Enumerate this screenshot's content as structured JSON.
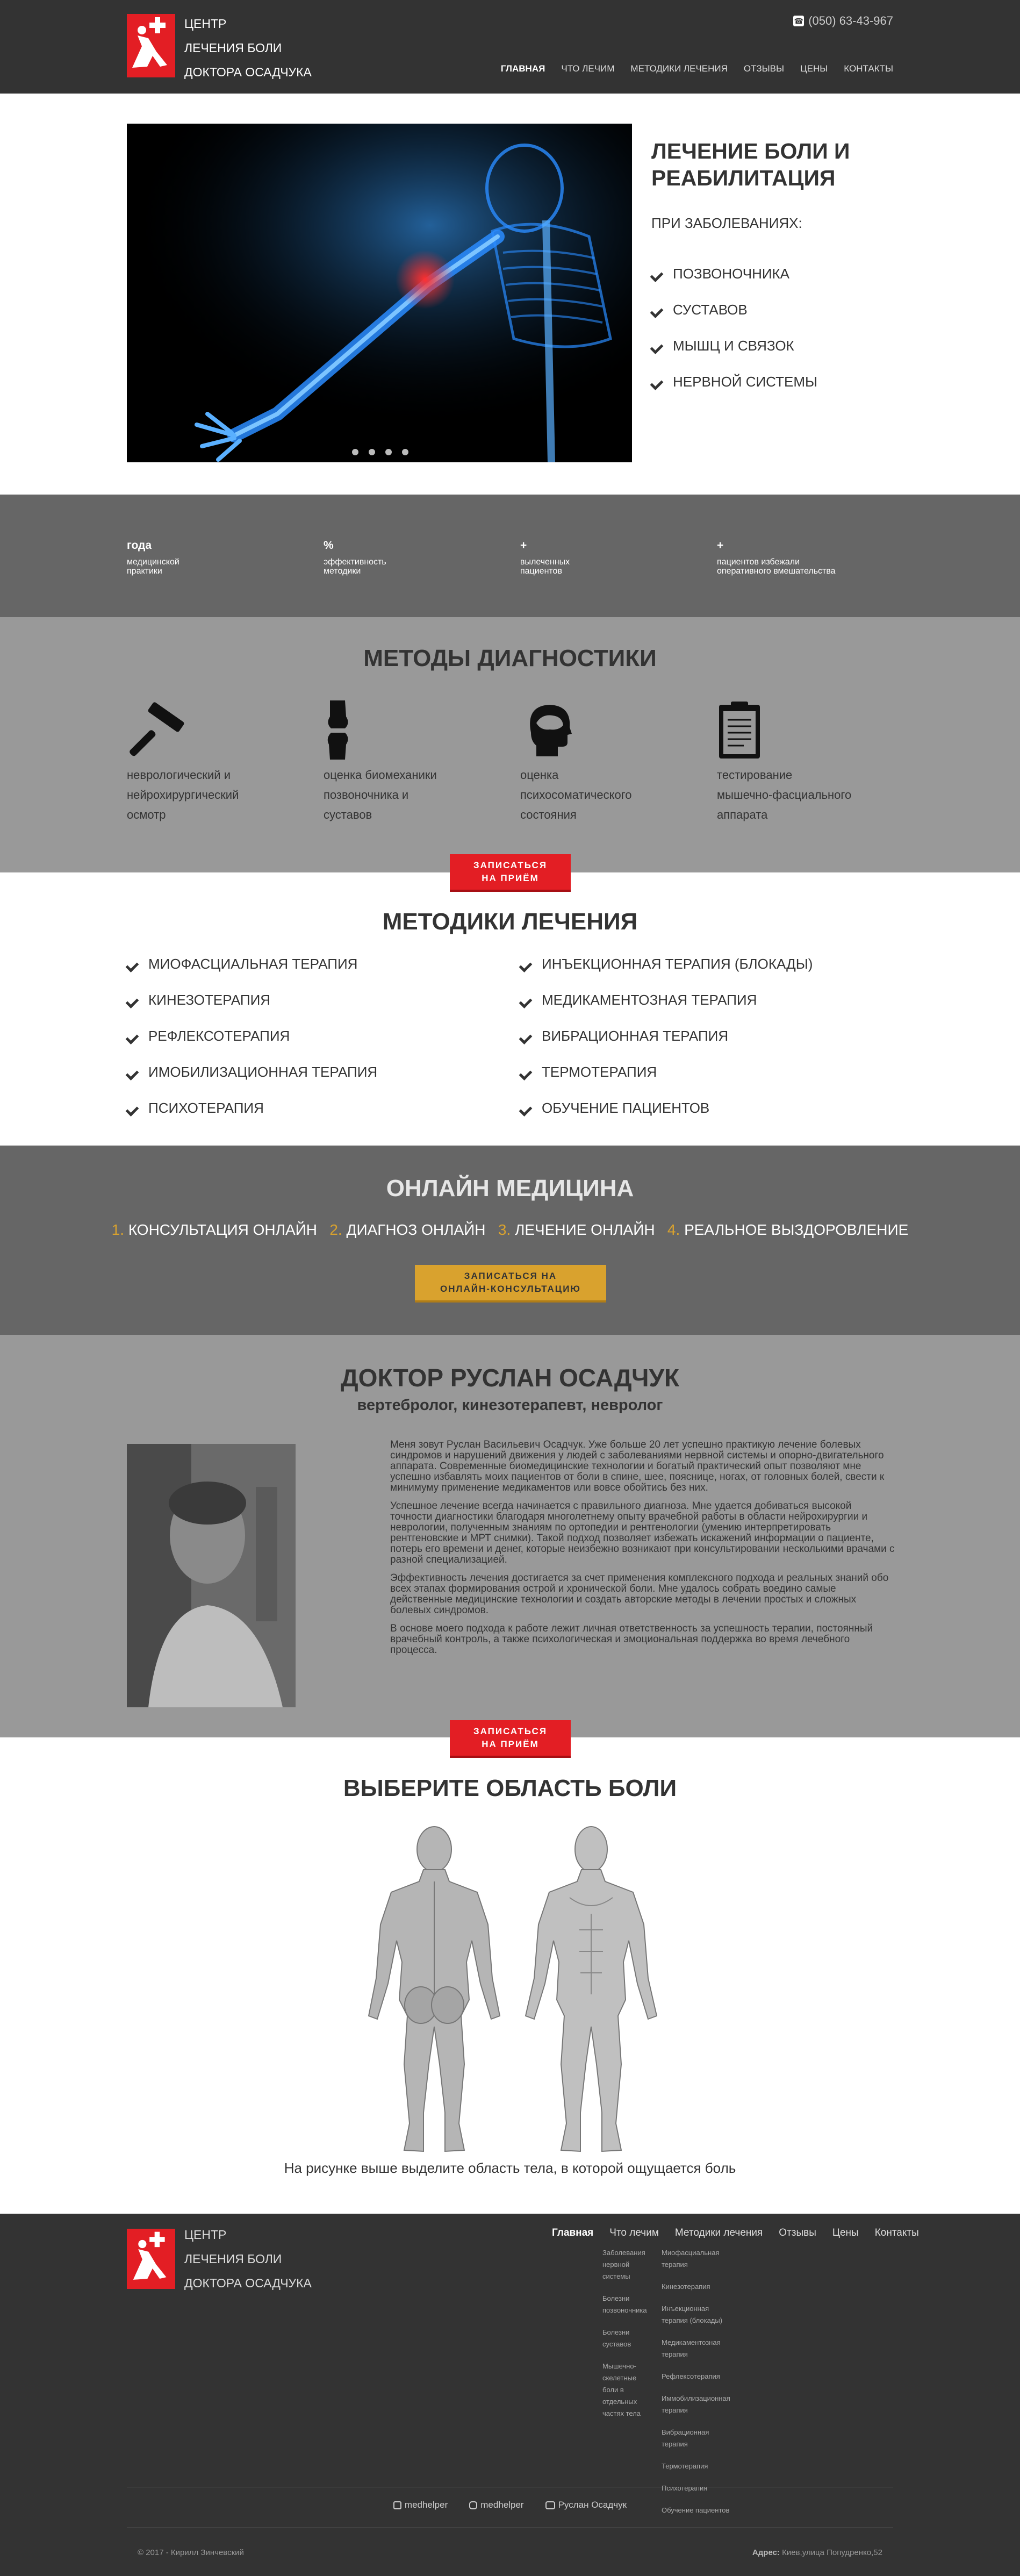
{
  "header": {
    "logo_lines": [
      "ЦЕНТР",
      "ЛЕЧЕНИЯ БОЛИ",
      "ДОКТОРА ОСАДЧУКА"
    ],
    "phone": "(050) 63-43-967",
    "nav": [
      "ГЛАВНАЯ",
      "ЧТО ЛЕЧИМ",
      "МЕТОДИКИ ЛЕЧЕНИЯ",
      "ОТЗЫВЫ",
      "ЦЕНЫ",
      "КОНТАКТЫ"
    ]
  },
  "hero": {
    "title": "ЛЕЧЕНИЕ БОЛИ И РЕАБИЛИТАЦИЯ",
    "subtitle": "ПРИ ЗАБОЛЕВАНИЯХ:",
    "items": [
      "ПОЗВОНОЧНИКА",
      "СУСТАВОВ",
      "МЫШЦ И СВЯЗОК",
      "НЕРВНОЙ СИСТЕМЫ"
    ],
    "slide_count": 4
  },
  "stats": [
    {
      "big": "года",
      "small": [
        "медицинской",
        "практики"
      ]
    },
    {
      "big": "%",
      "small": [
        "эффективность",
        "методики"
      ]
    },
    {
      "big": "+",
      "small": [
        "вылеченных",
        "пациентов"
      ]
    },
    {
      "big": "+",
      "small": [
        "пациентов избежали",
        "оперативного вмешательства"
      ]
    }
  ],
  "diagnostics": {
    "title": "МЕТОДЫ ДИАГНОСТИКИ",
    "items": [
      {
        "icon": "hammer-icon",
        "lines": [
          "неврологический и",
          "нейрохирургический",
          "осмотр"
        ]
      },
      {
        "icon": "knee-joint-icon",
        "lines": [
          "оценка биомеханики",
          "позвоночника и",
          "суставов"
        ]
      },
      {
        "icon": "head-brain-icon",
        "lines": [
          "оценка",
          "психосоматического",
          "состояния"
        ]
      },
      {
        "icon": "clipboard-icon",
        "lines": [
          "тестирование",
          "мышечно-фасциального",
          "аппарата"
        ]
      }
    ],
    "button": [
      "ЗАПИСАТЬСЯ",
      "НА ПРИЁМ"
    ]
  },
  "methods": {
    "title": "МЕТОДИКИ ЛЕЧЕНИЯ",
    "left": [
      "МИОФАСЦИАЛЬНАЯ ТЕРАПИЯ",
      "КИНЕЗОТЕРАПИЯ",
      "РЕФЛЕКСОТЕРАПИЯ",
      "ИМОБИЛИЗАЦИОННАЯ ТЕРАПИЯ",
      "ПСИХОТЕРАПИЯ"
    ],
    "right": [
      "ИНЪЕКЦИОННАЯ ТЕРАПИЯ (БЛОКАДЫ)",
      "МЕДИКАМЕНТОЗНАЯ ТЕРАПИЯ",
      "ВИБРАЦИОННАЯ ТЕРАПИЯ",
      "ТЕРМОТЕРАПИЯ",
      "ОБУЧЕНИЕ ПАЦИЕНТОВ"
    ]
  },
  "online": {
    "title": "ОНЛАЙН МЕДИЦИНА",
    "steps": [
      {
        "num": "1.",
        "label": "КОНСУЛЬТАЦИЯ ОНЛАЙН"
      },
      {
        "num": "2.",
        "label": "ДИАГНОЗ ОНЛАЙН"
      },
      {
        "num": "3.",
        "label": "ЛЕЧЕНИЕ ОНЛАЙН"
      },
      {
        "num": "4.",
        "label": "РЕАЛЬНОЕ ВЫЗДОРОВЛЕНИЕ"
      }
    ],
    "button": [
      "ЗАПИСАТЬСЯ НА",
      "ОНЛАЙН-КОНСУЛЬТАЦИЮ"
    ]
  },
  "doctor": {
    "name": "ДОКТОР РУСЛАН ОСАДЧУК",
    "specialty": "вертебролог, кинезотерапевт, невролог",
    "bio": [
      "Меня зовут Руслан Васильевич Осадчук. Уже больше 20 лет успешно практикую лечение болевых синдромов и нарушений движения у людей с заболеваниями нервной системы и опорно-двигательного аппарата. Современные биомедицинские технологии и богатый практический опыт позволяют мне успешно избавлять моих пациентов от боли в спине, шее, пояснице, ногах, от головных болей, свести к минимуму применение медикаментов или вовсе обойтись без них.",
      "Успешное лечение всегда начинается с правильного диагноза. Мне удается добиваться высокой точности диагностики благодаря многолетнему опыту врачебной работы в области нейрохирургии и неврологии, полученным знаниям по ортопедии и рентгенологии (умению интерпретировать рентгеновские и МРТ снимки). Такой подход позволяет избежать искажений информации о пациенте, потерь его времени и денег, которые неизбежно возникают при консультировании несколькими врачами с разной специализацией.",
      "Эффективность лечения достигается за счет применения комплексного подхода и реальных знаний обо всех этапах формирования острой и хронической боли. Мне удалось собрать воедино самые действенные медицинские технологии и создать авторские методы в лечении простых и сложных болевых синдромов.",
      "В основе моего подхода к работе лежит личная ответственность за успешность терапии, постоянный врачебный контроль, а также психологическая и эмоциональная поддержка во время лечебного процесса."
    ],
    "button": [
      "ЗАПИСАТЬСЯ",
      "НА ПРИЁМ"
    ]
  },
  "pain": {
    "title": "ВЫБЕРИТЕ ОБЛАСТЬ БОЛИ",
    "note": "На рисунке выше выделите область тела, в которой ощущается боль"
  },
  "footer": {
    "logo_lines": [
      "ЦЕНТР",
      "ЛЕЧЕНИЯ БОЛИ",
      "ДОКТОРА ОСАДЧУКА"
    ],
    "nav": [
      "Главная",
      "Что лечим",
      "Методики лечения",
      "Отзывы",
      "Цены",
      "Контакты"
    ],
    "col_what": [
      "Заболевания нервной системы",
      "Болезни позвоночника",
      "Болезни суставов",
      "Мышечно-скелетные боли в отдельных частях тела"
    ],
    "col_methods": [
      "Миофасциальная терапия",
      "Кинезотерапия",
      "Инъекционная терапия (блокады)",
      "Медикаментозная терапия",
      "Рефлексотерапия",
      "Иммобилизационная терапия",
      "Вибрационная терапия",
      "Термотерапия",
      "Психотерапия",
      "Обучение пациентов"
    ],
    "social": [
      "medhelper",
      "medhelper",
      "Руслан Осадчук"
    ],
    "copyright": "© 2017 - Кирилл Зинчевский",
    "address_label": "Адрес:",
    "address": "Киев,улица Попудренко,52"
  },
  "colors": {
    "accent_red": "#e31e24",
    "gold": "#d9a22e",
    "dark": "#333333"
  }
}
